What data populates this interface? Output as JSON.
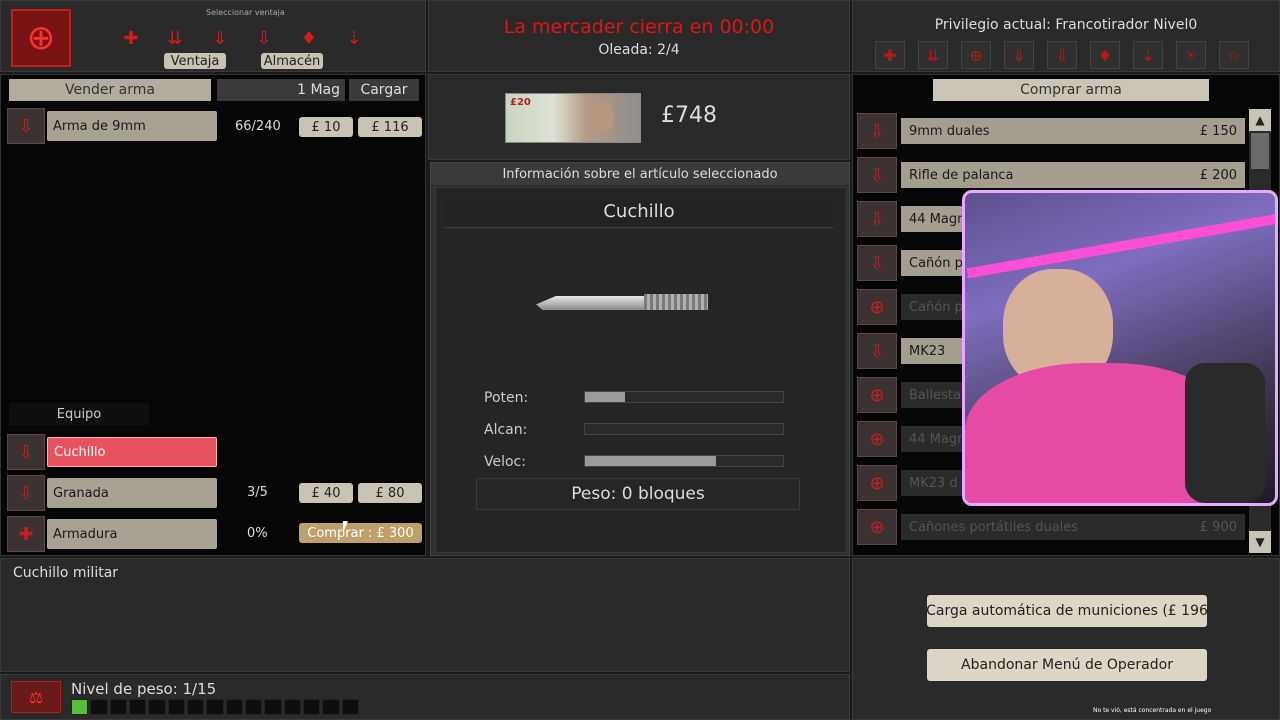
{
  "perks_top": {
    "title": "Seleccionar ventaja",
    "ventaja_label": "Ventaja",
    "almacen_label": "Almacén"
  },
  "header": {
    "trader_close": "La mercader cierra en 00:00",
    "wave": "Oleada: 2/4",
    "privilege": "Privilegio actual: Francotirador Nivel0"
  },
  "sell": {
    "title": "Vender arma",
    "mag_label": "1 Mag",
    "load_label": "Cargar",
    "weapons": [
      {
        "name": "Arma de 9mm",
        "ammo": "66/240",
        "mag_price": "£ 10",
        "fill_price": "£ 116"
      }
    ]
  },
  "equipment": {
    "title": "Equipo",
    "items": [
      {
        "name": "Cuchillo",
        "count": "",
        "btn1": "",
        "btn2": ""
      },
      {
        "name": "Granada",
        "count": "3/5",
        "btn1": "£ 40",
        "btn2": "£ 80"
      },
      {
        "name": "Armadura",
        "count": "0%",
        "btn1": "Comprar : £ 300",
        "btn2": ""
      }
    ]
  },
  "money": "£748",
  "info": {
    "title": "Información sobre el artículo seleccionado",
    "item_name": "Cuchillo",
    "stats": [
      {
        "label": "Poten:",
        "value": 0.2
      },
      {
        "label": "Alcan:",
        "value": 0.0
      },
      {
        "label": "Veloc:",
        "value": 0.66
      }
    ],
    "weight": "Peso: 0 bloques"
  },
  "buy": {
    "title": "Comprar arma",
    "items": [
      {
        "name": "9mm duales",
        "price": "£ 150",
        "active": true
      },
      {
        "name": "Rifle de palanca",
        "price": "£ 200",
        "active": true
      },
      {
        "name": "44 Magn",
        "price": "",
        "active": true
      },
      {
        "name": "Cañón p",
        "price": "",
        "active": true
      },
      {
        "name": "Cañón p",
        "price": "",
        "active": false
      },
      {
        "name": "MK23",
        "price": "",
        "active": true
      },
      {
        "name": "Ballesta",
        "price": "",
        "active": false
      },
      {
        "name": "44 Magn",
        "price": "",
        "active": false
      },
      {
        "name": "MK23 d",
        "price": "",
        "active": false
      },
      {
        "name": "Cañones portátiles duales",
        "price": "£ 900",
        "active": false
      }
    ]
  },
  "description": "Cuchillo militar",
  "weight_level": "Nivel de peso: 1/15",
  "weight_fraction": 0.0667,
  "actions": {
    "autobuy": "Carga automática de municiones (£ 196",
    "exit": "Abandonar Menú de Operador"
  },
  "stream_chat": "No te vió, está concentrada en el juego"
}
